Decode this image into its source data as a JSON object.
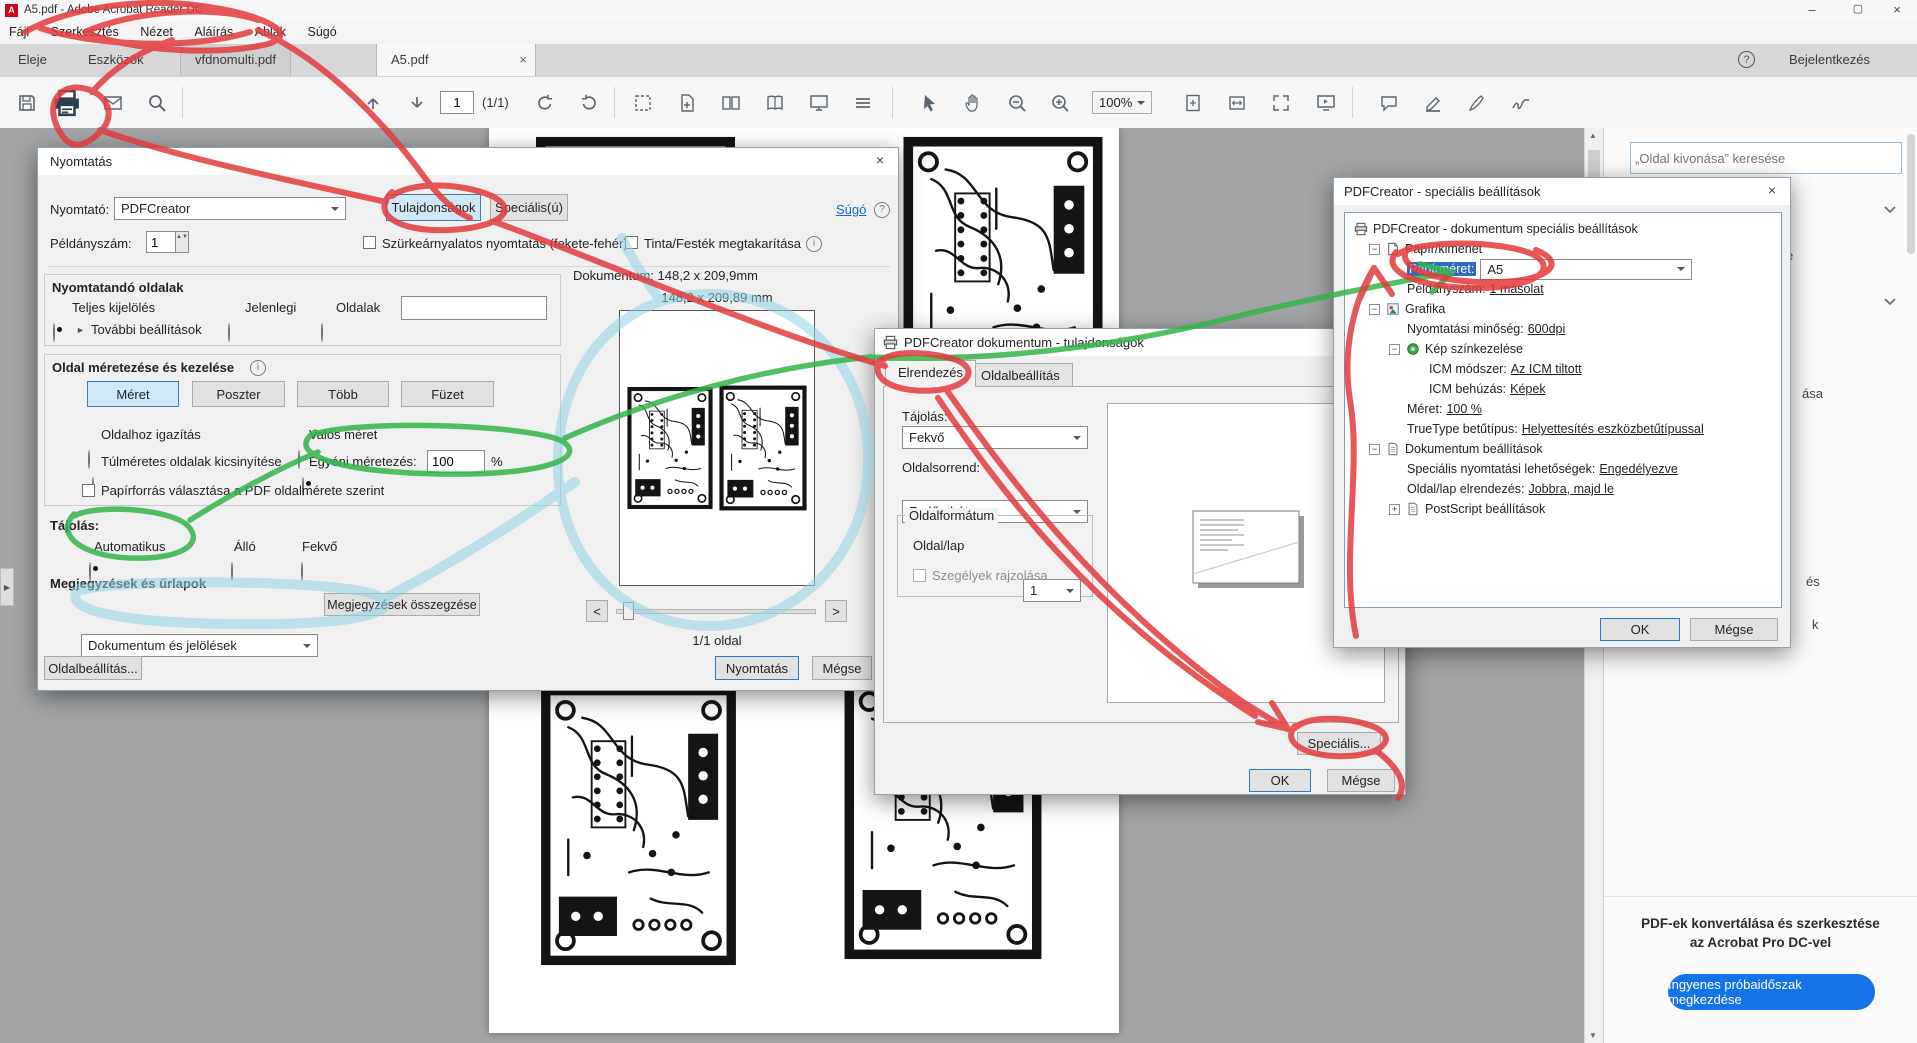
{
  "colors": {
    "accent_blue": "#1473e6",
    "selection_blue": "#316ac5",
    "annotation_red": "#e23b3c",
    "annotation_green": "#35b44a",
    "annotation_cyan": "#8ed4e6"
  },
  "icons": {
    "close": "×",
    "minimize": "–",
    "maximize": "▢",
    "help": "?",
    "info": "i",
    "left_arrow": "<",
    "right_arrow": ">",
    "more": "►",
    "pane_toggle": "▶",
    "expand_open": "−",
    "expand_closed": "+",
    "up_small": "▲",
    "down_small": "▼"
  },
  "titlebar": {
    "title": "A5.pdf - Adobe Acrobat Reader DC",
    "logo_letter": "A"
  },
  "menubar": {
    "items": [
      "Fájl",
      "Szerkesztés",
      "Nézet",
      "Aláírás",
      "Ablak",
      "Súgó"
    ]
  },
  "tabbar": {
    "home": "Eleje",
    "tools": "Eszközök",
    "tab1": "vfdnomulti.pdf",
    "tab2": "A5.pdf",
    "sign_in": "Bejelentkezés"
  },
  "toolbar": {
    "page_value": "1",
    "page_count": "(1/1)",
    "zoom_value": "100%"
  },
  "right_panel": {
    "search_placeholder": "„Oldal kivonása” keresése",
    "fragments": [
      "e",
      "ása",
      "és",
      "k"
    ],
    "promo_line1": "PDF-ek konvertálása és szerkesztése",
    "promo_line2": "az Acrobat Pro DC-vel",
    "promo_button": "Ingyenes próbaidőszak megkezdése"
  },
  "print_dialog": {
    "title": "Nyomtatás",
    "printer_label": "Nyomtató:",
    "printer_value": "PDFCreator",
    "properties_button": "Tulajdonságok",
    "advanced_button": "Speciális(ú)",
    "help_link": "Súgó",
    "copies_label": "Példányszám:",
    "copies_value": "1",
    "grayscale_label": "Szürkeárnyalatos nyomtatás (fekete-fehér)",
    "ink_label": "Tinta/Festék megtakarítása",
    "pages_group_title": "Nyomtatandó oldalak",
    "radio_all": "Teljes kijelölés",
    "radio_current": "Jelenlegi",
    "radio_pages": "Oldalak",
    "pages_value": "",
    "more_settings": "További beállítások",
    "sizing_group_title": "Oldal méretezése és kezelése",
    "btn_size": "Méret",
    "btn_poster": "Poszter",
    "btn_multiple": "Több",
    "btn_booklet": "Füzet",
    "radio_fit": "Oldalhoz igazítás",
    "radio_actual": "Valós méret",
    "radio_shrink": "Túlméretes oldalak kicsinyítése",
    "radio_custom": "Egyéni méretezés:",
    "custom_value": "100",
    "custom_unit": "%",
    "paper_source_label": "Papírforrás választása a PDF oldalmérete szerint",
    "orientation_title": "Tájolás:",
    "radio_auto": "Automatikus",
    "radio_portrait": "Álló",
    "radio_landscape": "Fekvő",
    "comments_group_title": "Megjegyzések és űrlapok",
    "comments_value": "Dokumentum és jelölések",
    "btn_summarize": "Megjegyzések összegzése",
    "doc_size": "Dokumentum: 148,2 x 209,9mm",
    "preview_size": "148,2 x 209,89 mm",
    "page_indicator": "1/1 oldal",
    "btn_page_setup": "Oldalbeállítás...",
    "btn_print": "Nyomtatás",
    "btn_cancel": "Mégse"
  },
  "props_dialog": {
    "title": "PDFCreator dokumentum - tulajdonságok",
    "tab_layout": "Elrendezés",
    "tab_paper": "Oldalbeállítás",
    "orientation_label": "Tájolás:",
    "orientation_value": "Fekvő",
    "order_label": "Oldalsorrend:",
    "order_value": "Fedő - hát",
    "format_group_title": "Oldalformátum",
    "pps_label": "Oldal/lap",
    "pps_value": "1",
    "borders_label": "Szegélyek rajzolása",
    "btn_advanced": "Speciális...",
    "btn_ok": "OK",
    "btn_cancel": "Mégse"
  },
  "adv_dialog": {
    "title": "PDFCreator - speciális beállítások",
    "btn_ok": "OK",
    "btn_cancel": "Mégse",
    "tree": [
      {
        "label": "PDFCreator - dokumentum speciális beállítások",
        "value": ""
      },
      {
        "label": "Papír/kimenet",
        "value": ""
      },
      {
        "label": "Papírméret:",
        "value": "A5"
      },
      {
        "label": "Példányszám:",
        "value": "1 másolat"
      },
      {
        "label": "Grafika",
        "value": ""
      },
      {
        "label": "Nyomtatási minőség:",
        "value": "600dpi"
      },
      {
        "label": "Kép színkezelése",
        "value": ""
      },
      {
        "label": "ICM módszer:",
        "value": "Az ICM tiltott"
      },
      {
        "label": "ICM behúzás:",
        "value": "Képek"
      },
      {
        "label": "Méret:",
        "value": "100 %"
      },
      {
        "label": "TrueType betűtípus:",
        "value": "Helyettesítés eszközbetűtípussal"
      },
      {
        "label": "Dokumentum beállítások",
        "value": ""
      },
      {
        "label": "Speciális nyomtatási lehetőségek:",
        "value": "Engedélyezve"
      },
      {
        "label": "Oldal/lap elrendezés:",
        "value": "Jobbra, majd le"
      },
      {
        "label": "PostScript beállítások",
        "value": ""
      }
    ]
  }
}
